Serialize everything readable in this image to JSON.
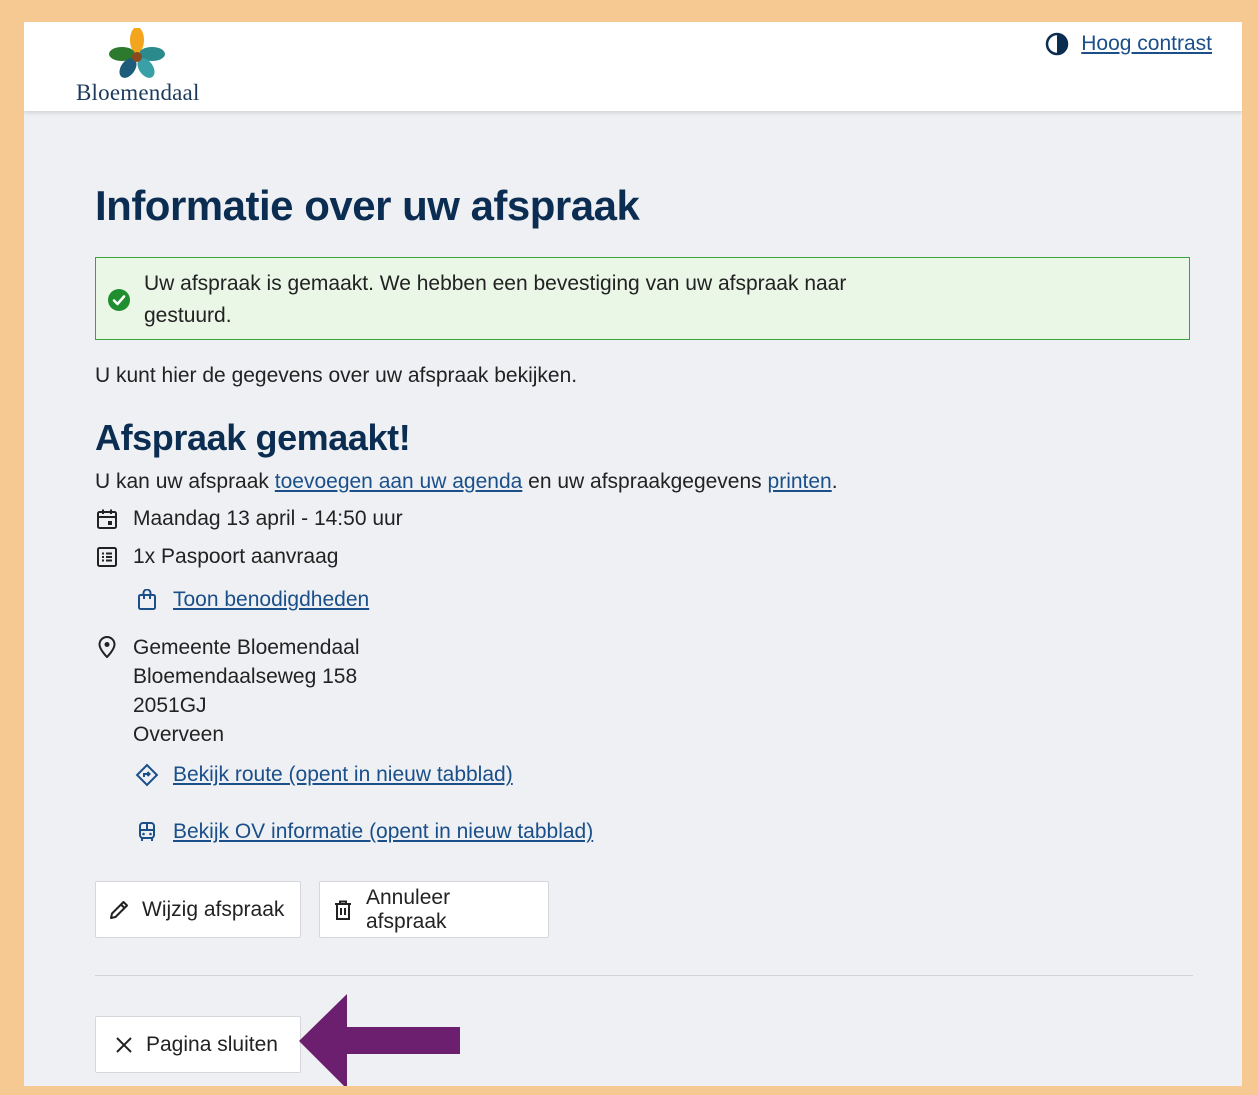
{
  "header": {
    "logo_text": "Bloemendaal",
    "contrast_label": "Hoog contrast"
  },
  "main": {
    "title": "Informatie over uw afspraak",
    "success_message": "Uw afspraak is gemaakt. We hebben een bevestiging van uw afspraak naar gestuurd.",
    "intro": "U kunt hier de gegevens over uw afspraak bekijken.",
    "subtitle": "Afspraak gemaakt!",
    "agenda_prefix": "U kan uw afspraak",
    "agenda_link": "toevoegen aan uw agenda",
    "agenda_middle": "en uw afspraakgegevens",
    "print_link": "printen",
    "agenda_suffix": ".",
    "datetime": "Maandag 13 april - 14:50 uur",
    "product": "1x Paspoort aanvraag",
    "requirements_link": "Toon benodigdheden",
    "address": {
      "name": "Gemeente Bloemendaal",
      "street": "Bloemendaalseweg 158",
      "postcode": "2051GJ",
      "city": "Overveen"
    },
    "route_link": "Bekijk route (opent in nieuw tabblad)",
    "ov_link": "Bekijk OV informatie (opent in nieuw tabblad)",
    "edit_button": "Wijzig afspraak",
    "cancel_button": "Annuleer afspraak",
    "close_button": "Pagina sluiten"
  },
  "colors": {
    "frame": "#f6c992",
    "heading": "#0b2d52",
    "link": "#1a4f8a",
    "success_border": "#3aa33a",
    "success_bg": "#eaf6e6",
    "annotation_arrow": "#6b1f6e"
  },
  "icons": [
    "contrast-icon",
    "check-circle-icon",
    "calendar-icon",
    "list-icon",
    "bag-icon",
    "map-pin-icon",
    "route-icon",
    "bus-icon",
    "pencil-icon",
    "trash-icon",
    "close-icon"
  ]
}
